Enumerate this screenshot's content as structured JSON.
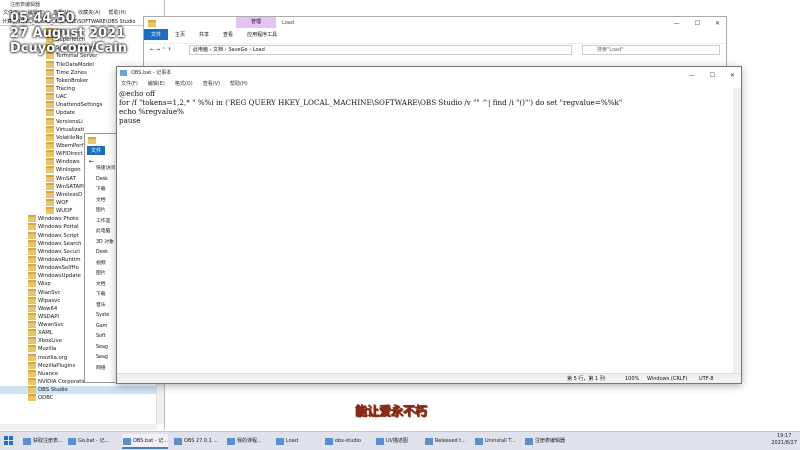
{
  "regedit": {
    "title": "注册表编辑器",
    "menu": [
      "文件(F)",
      "编辑(E)",
      "查看(V)",
      "收藏夹(A)",
      "帮助(H)"
    ],
    "address": "计算机\\HKEY_LOCAL_MACHINE\\SOFTWARE\\OBS Studio",
    "tree": [
      "SPP",
      "Superfetch",
      "SystemRestore",
      "Terminal Server",
      "TileDataModel",
      "Time Zones",
      "TokenBroker",
      "Tracing",
      "UAC",
      "UnattendSettings",
      "Update",
      "VersionsLi",
      "Virtualizati",
      "VolatileNo",
      "WbemPerf",
      "WiFiDirect",
      "Windows",
      "Winlogon",
      "WinSAT",
      "WinSATAPI",
      "WirelessD",
      "WOF",
      "WUDF",
      "Windows Photo",
      "Windows Portal",
      "Windows Script",
      "Windows Search",
      "Windows Securi",
      "WindowsRuntim",
      "WindowsSelfHo",
      "WindowsUpdate",
      "Wisp",
      "WlanSvc",
      "Wlpasvc",
      "Wow64",
      "WSDAPI",
      "WwanSvc",
      "XAML",
      "XboxLive",
      "Mozilla",
      "mozilla.org",
      "MozillaPlugins",
      "Nuance",
      "NVIDIA Corporation",
      "OBS Studio",
      "ODBC"
    ],
    "selected": "OBS Studio"
  },
  "watermark": {
    "line1": "05:44:50",
    "line2": "27 August 2021",
    "line3": "Dcuyo.com/Cain"
  },
  "explorer_load": {
    "title": "Load",
    "context_tab": "管理",
    "tabs": [
      "文件",
      "主页",
      "共享",
      "查看",
      "应用程序工具"
    ],
    "breadcrumb": "此电脑 › 文档 › SaveGo › Load",
    "search_placeholder": "搜索\"Load\"",
    "nav_arrows": "←  →  ⌃  ↑"
  },
  "explorer2": {
    "tab": "文件",
    "nav": [
      "快速访问",
      "Desk",
      "下载",
      "文档",
      "图片",
      "工作室",
      "此电脑",
      "3D 对象",
      "Desk",
      "视频",
      "图片",
      "文档",
      "下载",
      "音乐",
      "Syste",
      "Gam",
      "Soft",
      "Seag",
      "Seag",
      "网络"
    ]
  },
  "notepad": {
    "title": "OBS.bat - 记事本",
    "menu": [
      "文件(F)",
      "编辑(E)",
      "格式(O)",
      "查看(V)",
      "帮助(H)"
    ],
    "lines": [
      "@echo off",
      "for /f \"tokens=1,2,* \" %%i in ('REG QUERY HKEY_LOCAL_MACHINE\\SOFTWARE\\OBS Studio /v \"\" ^| find /i \"()\"') do set \"regvalue=%%k\"",
      "echo %regvalue%",
      "pause"
    ],
    "status": {
      "position": "第 5 行，第 1 列",
      "zoom": "100%",
      "eol": "Windows (CRLF)",
      "encoding": "UTF-8"
    }
  },
  "subtitle": "能让爱永不朽",
  "taskbar": {
    "items": [
      "获取注册表...",
      "Go.bat - 记...",
      "OBS.bat - 记...",
      "OBS 27.0.1 ...",
      "我的课程...",
      "Load",
      "obs-studio",
      "UI/描述图",
      "Released t...",
      "Uninstall T...",
      "注册表编辑器"
    ],
    "time": "19:17",
    "date": "2021/8/27"
  }
}
